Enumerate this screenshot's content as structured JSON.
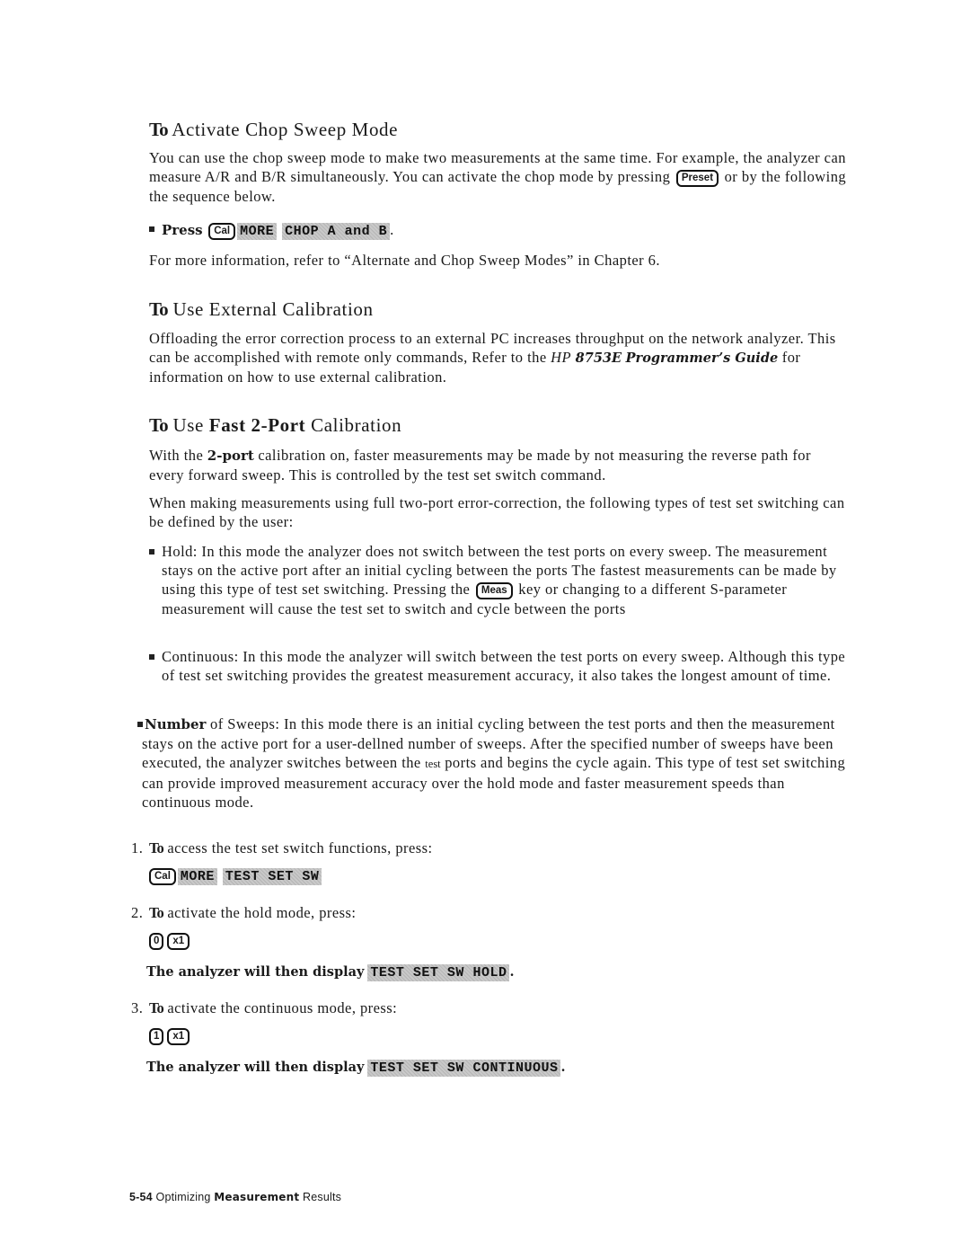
{
  "sections": {
    "chop": {
      "heading_to": "To",
      "heading_rest": "Activate Chop Sweep Mode",
      "para1_part1": "You can use the chop sweep mode to make two measurements at the same time. For example, the analyzer can measure A/R and B/R simultaneously. You can activate the chop mode by pressing",
      "para1_key": "Preset",
      "para1_part2": "or by the following the sequence below.",
      "press_label": "Press",
      "press_key": "Cal",
      "softkeys": [
        "MORE",
        "CHOP A and B"
      ],
      "press_end": ".",
      "para2": "For more information, refer to “Alternate and Chop Sweep Modes” in Chapter 6."
    },
    "external": {
      "heading_to": "To",
      "heading_rest": "Use External Calibration",
      "para_part1": "Offloading the error correction process to an external PC increases throughput on the network analyzer. This can be accomplished with remote only commands, Refer to the",
      "ref_hp": "HP",
      "ref_model": "8753E",
      "ref_guide": "Programmer’s Guide",
      "para_part2": "for information on how to use external calibration."
    },
    "fast": {
      "heading_to": "To",
      "heading_use": "Use",
      "heading_bold": "Fast 2-Port",
      "heading_rest": "Calibration",
      "para1_pre": "With the",
      "para1_bold": "2-port",
      "para1_post": "calibration on, faster measurements may be made by not measuring the reverse path for every forward sweep. This is controlled by the test set switch command.",
      "para2": "When making measurements using full two-port error-correction, the following types of test set switching can be defined by the user:",
      "bullets": {
        "hold_part1": "Hold: In this mode the analyzer does not switch between the test ports on every sweep. The measurement stays on the active port after an initial cycling between the ports The fastest measurements can be made by using this type of test set switching. Pressing the",
        "hold_key": "Meas",
        "hold_part2": "key or changing to a different S-parameter measurement will cause the test set to switch and cycle between the ports",
        "continuous": "Continuous: In this mode the analyzer will switch between the test ports on every sweep. Although this type of test set switching provides the greatest measurement accuracy, it also takes the longest amount of time.",
        "number_bold": "Number",
        "number_part1": "of Sweeps: In this mode there is an initial cycling between the test ports and then the measurement stays on the active port for a user-dellned number of sweeps. After the specified number of sweeps have been executed, the analyzer switches between the",
        "number_small": "test",
        "number_part2": "ports and begins the cycle again. This type of test set switching can provide improved measurement accuracy over the hold mode and faster measurement speeds than continuous mode."
      },
      "steps": [
        {
          "num": "1.",
          "to": "To",
          "text": "access the test set switch functions, press:",
          "key": "Cal",
          "softkeys": [
            "MORE",
            "TEST SET SW"
          ]
        },
        {
          "num": "2.",
          "to": "To",
          "text": "activate the hold mode, press:",
          "keys": [
            "0",
            "x1"
          ],
          "display_label": "The analyzer will then display",
          "display_value": "TEST SET SW HOLD",
          "display_end": "."
        },
        {
          "num": "3.",
          "to": "To",
          "text": "activate the continuous mode, press:",
          "keys": [
            "1",
            "x1"
          ],
          "display_label": "The analyzer will then display",
          "display_value": "TEST SET SW CONTINUOUS",
          "display_end": "."
        }
      ]
    }
  },
  "footer": {
    "page_number": "5-54",
    "title_1": "Optimizing",
    "title_2": "Measurement",
    "title_3": "Results"
  }
}
